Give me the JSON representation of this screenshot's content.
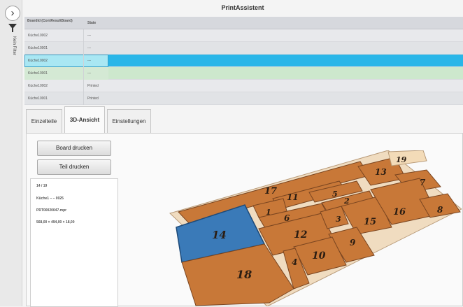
{
  "app": {
    "title": "PrintAssistent"
  },
  "leftbar": {
    "expand_glyph": "›",
    "filter_label": "Kein Filter"
  },
  "table": {
    "columns": [
      "BoardId\n(ContResultBoard)",
      "State"
    ],
    "column_1": "BoardId (ContResultBoard)",
    "column_2": "State",
    "rows": [
      {
        "board_id": "Küche10002",
        "state": "---"
      },
      {
        "board_id": "Küche10001",
        "state": "---"
      },
      {
        "board_id": "Küche10002",
        "state": "---"
      },
      {
        "board_id": "Küche10001",
        "state": "---"
      },
      {
        "board_id": "Küche10002",
        "state": "Printed"
      },
      {
        "board_id": "Küche10001",
        "state": "Printed"
      }
    ]
  },
  "tabs": [
    "Einzelteile",
    "3D-Ansicht",
    "Einstellungen"
  ],
  "active_tab": "3D-Ansicht",
  "buttons": {
    "board_print": "Board drucken",
    "part_print": "Teil drucken"
  },
  "info": {
    "counter": "14 / 19",
    "name": "Küche1 – – 0025",
    "file": "PRT00020047.mpr",
    "size": "568,00 × 494,00 × 18,00"
  },
  "parts": [
    "1",
    "2",
    "3",
    "4",
    "5",
    "6",
    "7",
    "8",
    "9",
    "10",
    "11",
    "12",
    "13",
    "14",
    "15",
    "16",
    "17",
    "18",
    "19"
  ],
  "colors": {
    "selection": "#29b6e8",
    "selected_part": "#3a7ab8",
    "part": "#c87838",
    "board": "#f0dcc0"
  }
}
